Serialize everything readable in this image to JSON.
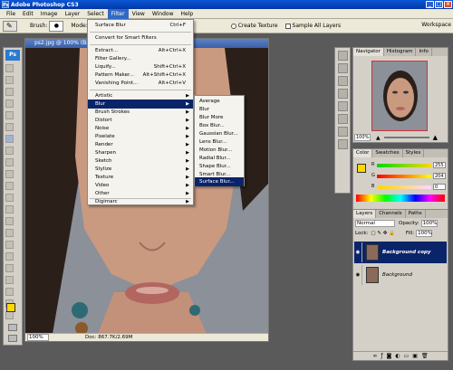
{
  "app": {
    "title": "Adobe Photoshop CS3"
  },
  "menubar": [
    "File",
    "Edit",
    "Image",
    "Layer",
    "Select",
    "Filter",
    "View",
    "Window",
    "Help"
  ],
  "options": {
    "brush_label": "Brush:",
    "mode_label": "Mode:",
    "create_texture": "Create Texture",
    "sample_all_layers": "Sample All Layers",
    "workspace": "Workspace"
  },
  "document": {
    "title": "ps2.jpg @ 100% (Ba",
    "zoom": "100%",
    "doc_info": "Doc: 867.7K/2.69M"
  },
  "filter_menu": {
    "top": [
      {
        "label": "Surface Blur",
        "shortcut": "Ctrl+F"
      },
      {
        "label": "Convert for Smart Filters",
        "shortcut": ""
      }
    ],
    "middle": [
      {
        "label": "Extract...",
        "shortcut": "Alt+Ctrl+X"
      },
      {
        "label": "Filter Gallery...",
        "shortcut": ""
      },
      {
        "label": "Liquify...",
        "shortcut": "Shift+Ctrl+X"
      },
      {
        "label": "Pattern Maker...",
        "shortcut": "Alt+Shift+Ctrl+X"
      },
      {
        "label": "Vanishing Point...",
        "shortcut": "Alt+Ctrl+V"
      }
    ],
    "submenus": [
      "Artistic",
      "Blur",
      "Brush Strokes",
      "Distort",
      "Noise",
      "Pixelate",
      "Render",
      "Sharpen",
      "Sketch",
      "Stylize",
      "Texture",
      "Video",
      "Other"
    ],
    "bottom": [
      "Digimarc"
    ]
  },
  "blur_submenu": [
    "Average",
    "Blur",
    "Blur More",
    "Box Blur...",
    "Gaussian Blur...",
    "Lens Blur...",
    "Motion Blur...",
    "Radial Blur...",
    "Shape Blur...",
    "Smart Blur...",
    "Surface Blur..."
  ],
  "navigator": {
    "tabs": [
      "Navigator",
      "Histogram",
      "Info"
    ],
    "zoom": "100%"
  },
  "color_panel": {
    "tabs": [
      "Color",
      "Swatches",
      "Styles"
    ],
    "R": "255",
    "G": "204",
    "B": "0",
    "labels": [
      "R",
      "G",
      "B"
    ],
    "foreground": "#ffd800"
  },
  "layers_panel": {
    "tabs": [
      "Layers",
      "Channels",
      "Paths"
    ],
    "blend_mode": "Normal",
    "opacity_label": "Opacity:",
    "opacity": "100%",
    "lock_label": "Lock:",
    "fill_label": "Fill:",
    "fill": "100%",
    "layers": [
      {
        "name": "Background copy",
        "selected": true
      },
      {
        "name": "Background",
        "selected": false
      }
    ]
  },
  "colors": {
    "titlebar": "#0a58d8",
    "menu_highlight": "#0a246a"
  }
}
